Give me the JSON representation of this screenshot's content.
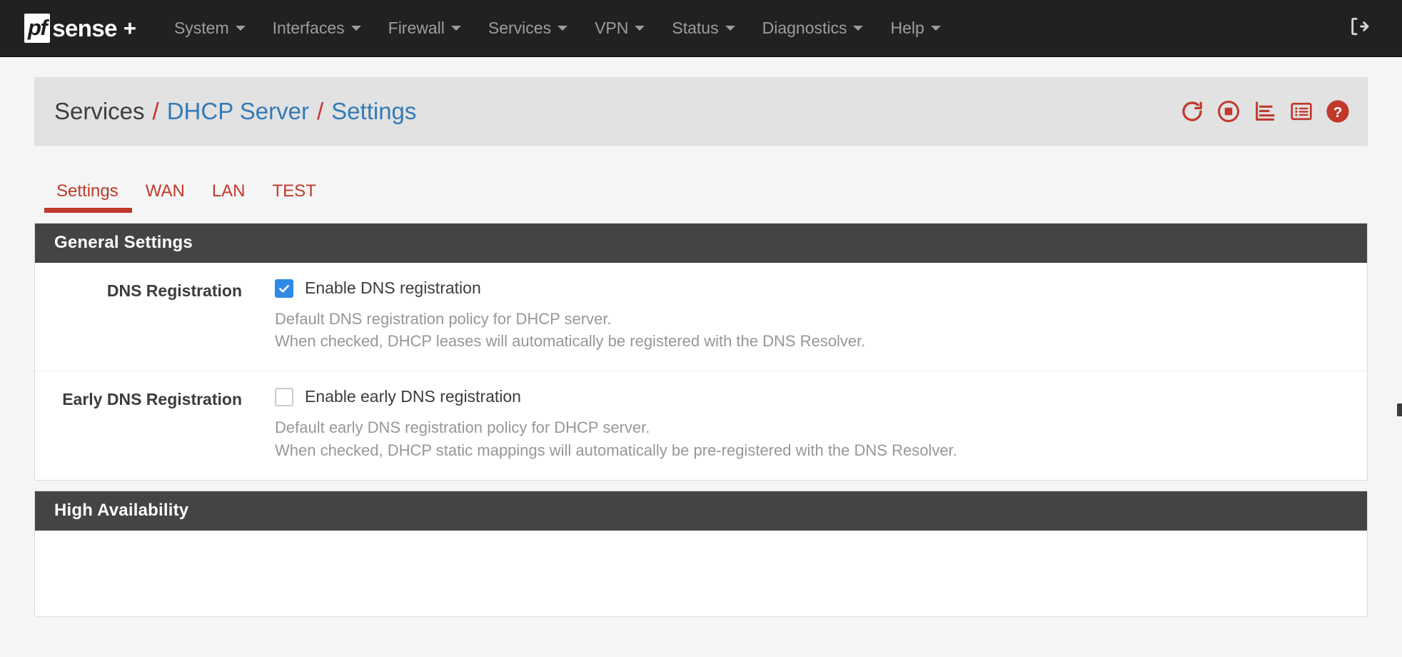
{
  "navbar": {
    "brand": {
      "badge": "pf",
      "word": "sense",
      "plus": "+"
    },
    "menu": [
      {
        "label": "System",
        "has_caret": true
      },
      {
        "label": "Interfaces",
        "has_caret": true
      },
      {
        "label": "Firewall",
        "has_caret": true
      },
      {
        "label": "Services",
        "has_caret": true
      },
      {
        "label": "VPN",
        "has_caret": true
      },
      {
        "label": "Status",
        "has_caret": true
      },
      {
        "label": "Diagnostics",
        "has_caret": true
      },
      {
        "label": "Help",
        "has_caret": true
      }
    ],
    "signout_icon": "sign-out-icon"
  },
  "breadcrumb": {
    "root": "Services",
    "sep1": "/",
    "link1": "DHCP Server",
    "sep2": "/",
    "link2": "Settings",
    "actions": [
      {
        "name": "restart-service-icon"
      },
      {
        "name": "stop-service-icon"
      },
      {
        "name": "service-status-log-icon"
      },
      {
        "name": "related-settings-icon"
      },
      {
        "name": "help-icon"
      }
    ]
  },
  "tabs": [
    {
      "label": "Settings",
      "active": true
    },
    {
      "label": "WAN",
      "active": false
    },
    {
      "label": "LAN",
      "active": false
    },
    {
      "label": "TEST",
      "active": false
    }
  ],
  "panels": [
    {
      "title": "General Settings",
      "rows": [
        {
          "label": "DNS Registration",
          "checkbox_label": "Enable DNS registration",
          "checked": true,
          "help": [
            "Default DNS registration policy for DHCP server.",
            "When checked, DHCP leases will automatically be registered with the DNS Resolver."
          ]
        },
        {
          "label": "Early DNS Registration",
          "checkbox_label": "Enable early DNS registration",
          "checked": false,
          "help": [
            "Default early DNS registration policy for DHCP server.",
            "When checked, DHCP static mappings will automatically be pre-registered with the DNS Resolver."
          ]
        }
      ]
    },
    {
      "title": "High Availability",
      "rows": []
    }
  ],
  "colors": {
    "navbar_bg": "#212121",
    "accent_red": "#c0392b",
    "link_blue": "#337ab7",
    "panel_heading_bg": "#444444",
    "checkbox_blue": "#2e8ae6",
    "help_gray": "#979797"
  }
}
